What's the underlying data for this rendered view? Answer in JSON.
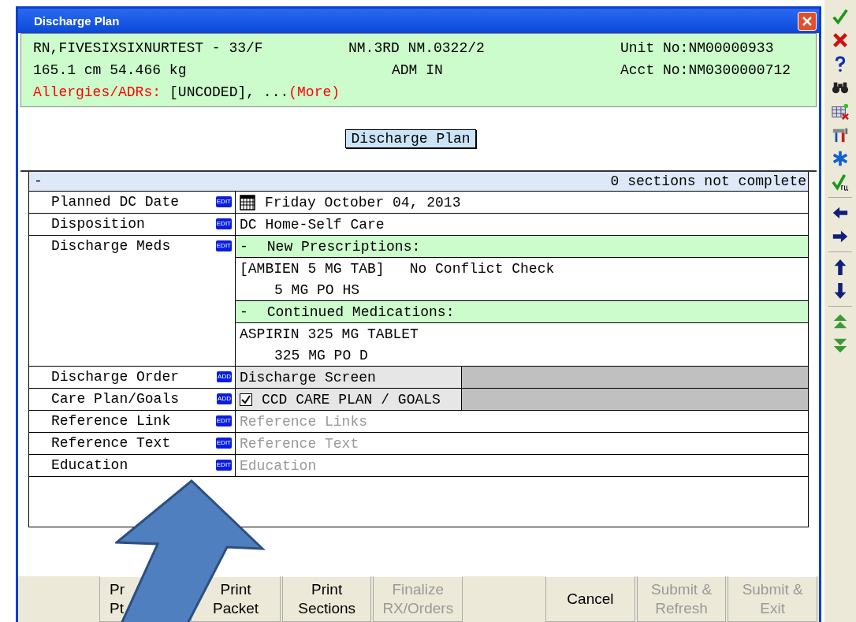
{
  "window": {
    "title": "Discharge Plan"
  },
  "header": {
    "patient": "RN,FIVESIXSIXNURTEST - 33/F",
    "location": "NM.3RD NM.0322/2",
    "unit_no": "Unit No:NM00000933",
    "measurements": "165.1 cm 54.466 kg",
    "status": "ADM IN",
    "acct_no": "Acct No:NM0300000712",
    "allergies_label": "Allergies/ADRs:",
    "allergies_value": "[UNCODED], ...",
    "more_link": "(More)"
  },
  "section_button": "Discharge Plan",
  "table": {
    "collapse": "-",
    "status": "0 sections not complete",
    "rows": [
      {
        "label": "Planned DC Date",
        "action": "EDIT",
        "kind": "date",
        "value": "Friday October 04, 2013"
      },
      {
        "label": "Disposition",
        "action": "EDIT",
        "kind": "text",
        "value": "DC Home-Self Care"
      },
      {
        "label": "Discharge Meds",
        "action": "EDIT",
        "kind": "meds",
        "lines": [
          {
            "kind": "header",
            "toggle": "-",
            "text": "New Prescriptions:"
          },
          {
            "kind": "item",
            "text": "[AMBIEN 5 MG TAB]",
            "note": "No Conflict Check"
          },
          {
            "kind": "detail",
            "text": "5 MG PO HS"
          },
          {
            "kind": "header",
            "toggle": "-",
            "text": "Continued Medications:"
          },
          {
            "kind": "item",
            "text": "ASPIRIN 325 MG TABLET"
          },
          {
            "kind": "detail",
            "text": "325 MG PO D"
          }
        ]
      },
      {
        "label": "Discharge Order",
        "action": "ADD",
        "kind": "order",
        "value": "Discharge Screen"
      },
      {
        "label": "Care Plan/Goals",
        "action": "ADD",
        "kind": "checkbox",
        "checked": true,
        "value": "CCD CARE PLAN / GOALS"
      },
      {
        "label": "Reference Link",
        "action": "EDIT",
        "kind": "placeholder",
        "value": "Reference Links"
      },
      {
        "label": "Reference Text",
        "action": "EDIT",
        "kind": "placeholder",
        "value": "Reference Text"
      },
      {
        "label": "Education",
        "action": "EDIT",
        "kind": "placeholder",
        "value": "Education"
      }
    ]
  },
  "buttons": [
    {
      "kind": "spacer"
    },
    {
      "kind": "partial",
      "lines": [
        "Pr",
        "Pt"
      ],
      "disabled": false
    },
    {
      "kind": "button",
      "lines": [
        "Print",
        "Packet"
      ],
      "disabled": false
    },
    {
      "kind": "button",
      "lines": [
        "Print",
        "Sections"
      ],
      "disabled": false
    },
    {
      "kind": "button",
      "lines": [
        "Finalize",
        "RX/Orders"
      ],
      "disabled": true
    },
    {
      "kind": "spacer"
    },
    {
      "kind": "button",
      "lines": [
        "Cancel"
      ],
      "disabled": false
    },
    {
      "kind": "button",
      "lines": [
        "Submit &",
        "Refresh"
      ],
      "disabled": true
    },
    {
      "kind": "button",
      "lines": [
        "Submit &",
        "Exit"
      ],
      "disabled": true
    }
  ]
}
